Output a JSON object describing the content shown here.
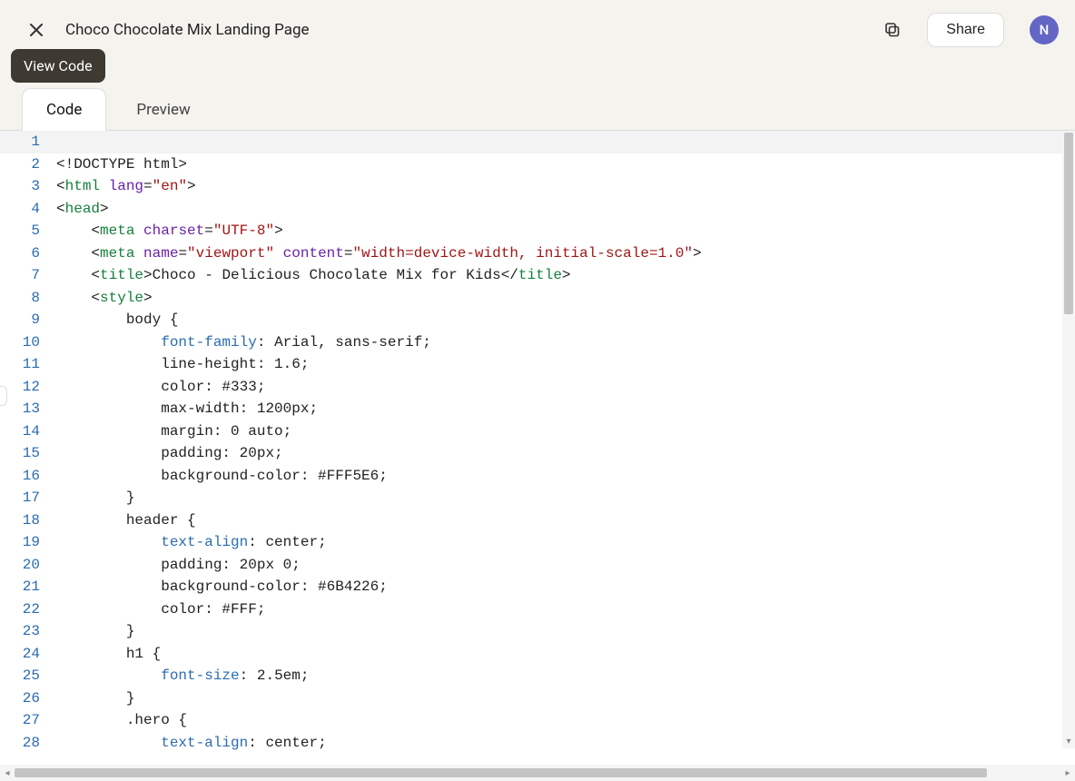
{
  "header": {
    "title": "Choco Chocolate Mix Landing Page",
    "share_label": "Share",
    "avatar_letter": "N",
    "tooltip": "View Code"
  },
  "tabs": {
    "code": "Code",
    "preview": "Preview"
  },
  "code": {
    "lines": [
      {
        "n": 1,
        "html": ""
      },
      {
        "n": 2,
        "html": "<span class='tok-punct'>&lt;!</span><span class='tok-doctype'>DOCTYPE html</span><span class='tok-punct'>&gt;</span>"
      },
      {
        "n": 3,
        "html": "<span class='tok-punct'>&lt;</span><span class='tok-tag'>html</span> <span class='tok-attr'>lang</span><span class='tok-punct'>=</span><span class='tok-str'>\"en\"</span><span class='tok-punct'>&gt;</span>"
      },
      {
        "n": 4,
        "html": "<span class='tok-punct'>&lt;</span><span class='tok-tag'>head</span><span class='tok-punct'>&gt;</span>"
      },
      {
        "n": 5,
        "html": "    <span class='tok-punct'>&lt;</span><span class='tok-tag'>meta</span> <span class='tok-attr'>charset</span><span class='tok-punct'>=</span><span class='tok-str'>\"UTF-8\"</span><span class='tok-punct'>&gt;</span>"
      },
      {
        "n": 6,
        "html": "    <span class='tok-punct'>&lt;</span><span class='tok-tag'>meta</span> <span class='tok-attr'>name</span><span class='tok-punct'>=</span><span class='tok-str'>\"viewport\"</span> <span class='tok-attr'>content</span><span class='tok-punct'>=</span><span class='tok-str'>\"width=device-width, initial-scale=1.0\"</span><span class='tok-punct'>&gt;</span>"
      },
      {
        "n": 7,
        "html": "    <span class='tok-punct'>&lt;</span><span class='tok-tag'>title</span><span class='tok-punct'>&gt;</span><span class='tok-text'>Choco - Delicious Chocolate Mix for Kids</span><span class='tok-punct'>&lt;/</span><span class='tok-tag'>title</span><span class='tok-punct'>&gt;</span>"
      },
      {
        "n": 8,
        "html": "    <span class='tok-punct'>&lt;</span><span class='tok-tag'>style</span><span class='tok-punct'>&gt;</span>"
      },
      {
        "n": 9,
        "html": "        <span class='tok-sel'>body {</span>"
      },
      {
        "n": 10,
        "html": "            <span class='tok-prop'>font-family</span><span class='tok-punct'>:</span> <span class='tok-val'>Arial, sans-serif;</span>"
      },
      {
        "n": 11,
        "html": "            <span class='tok-val'>line-height: 1.6;</span>"
      },
      {
        "n": 12,
        "html": "            <span class='tok-val'>color: #333;</span>"
      },
      {
        "n": 13,
        "html": "            <span class='tok-val'>max-width: 1200px;</span>"
      },
      {
        "n": 14,
        "html": "            <span class='tok-val'>margin: 0 auto;</span>"
      },
      {
        "n": 15,
        "html": "            <span class='tok-val'>padding: 20px;</span>"
      },
      {
        "n": 16,
        "html": "            <span class='tok-val'>background-color: #FFF5E6;</span>"
      },
      {
        "n": 17,
        "html": "        <span class='tok-sel'>}</span>"
      },
      {
        "n": 18,
        "html": "        <span class='tok-sel'>header {</span>"
      },
      {
        "n": 19,
        "html": "            <span class='tok-prop'>text-align</span><span class='tok-punct'>:</span> <span class='tok-val'>center;</span>"
      },
      {
        "n": 20,
        "html": "            <span class='tok-val'>padding: 20px 0;</span>"
      },
      {
        "n": 21,
        "html": "            <span class='tok-val'>background-color: #6B4226;</span>"
      },
      {
        "n": 22,
        "html": "            <span class='tok-val'>color: #FFF;</span>"
      },
      {
        "n": 23,
        "html": "        <span class='tok-sel'>}</span>"
      },
      {
        "n": 24,
        "html": "        <span class='tok-sel'>h1 {</span>"
      },
      {
        "n": 25,
        "html": "            <span class='tok-prop'>font-size</span><span class='tok-punct'>:</span> <span class='tok-val'>2.5em;</span>"
      },
      {
        "n": 26,
        "html": "        <span class='tok-sel'>}</span>"
      },
      {
        "n": 27,
        "html": "        <span class='tok-sel'>.hero {</span>"
      },
      {
        "n": 28,
        "html": "            <span class='tok-prop'>text-align</span><span class='tok-punct'>:</span> <span class='tok-val'>center;</span>"
      }
    ]
  }
}
